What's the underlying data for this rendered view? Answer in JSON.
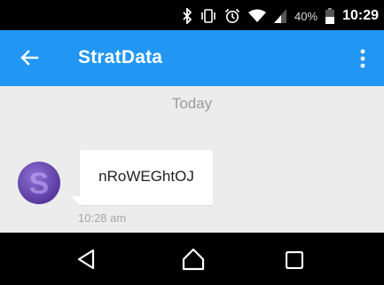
{
  "status_bar": {
    "battery_percent": "40%",
    "time": "10:29",
    "icons": [
      "bluetooth-icon",
      "vibrate-icon",
      "alarm-icon",
      "wifi-icon",
      "signal-icon",
      "battery-icon"
    ]
  },
  "app_bar": {
    "title": "StratData",
    "back_icon": "arrow-back-icon",
    "menu_icon": "more-vert-icon",
    "color": "#2196f3"
  },
  "conversation": {
    "date_separator": "Today",
    "messages": [
      {
        "avatar_letter": "S",
        "text": "nRoWEGhtOJ",
        "time": "10:28 am"
      }
    ]
  },
  "nav_bar": {
    "icons": [
      "nav-back-icon",
      "nav-home-icon",
      "nav-recents-icon"
    ]
  }
}
